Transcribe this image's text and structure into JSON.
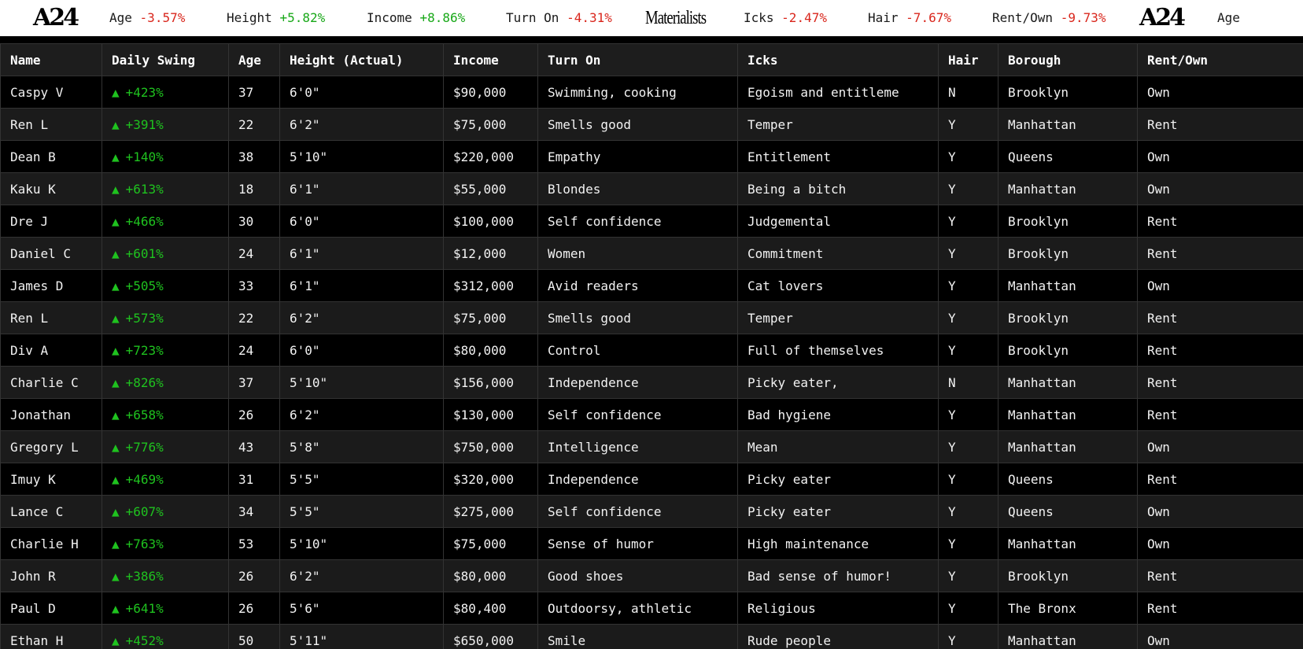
{
  "ticker": {
    "logo_a24": "A24",
    "logo_materialists": "Materialists",
    "items": [
      {
        "label": "Age",
        "value": "-3.57%"
      },
      {
        "label": "Height",
        "value": "+5.82%"
      },
      {
        "label": "Income",
        "value": "+8.86%"
      },
      {
        "label": "Turn On",
        "value": "-4.31%"
      },
      {
        "label": "Icks",
        "value": "-2.47%"
      },
      {
        "label": "Hair",
        "value": "-7.67%"
      },
      {
        "label": "Rent/Own",
        "value": "-9.73%"
      },
      {
        "label": "Age",
        "value": ""
      }
    ]
  },
  "table": {
    "headers": [
      "Name",
      "Daily Swing",
      "Age",
      "Height (Actual)",
      "Income",
      "Turn On",
      "Icks",
      "Hair",
      "Borough",
      "Rent/Own"
    ],
    "swing_icon": "▲",
    "rows": [
      [
        "Caspy V",
        "+423%",
        "37",
        "6'0\"",
        "$90,000",
        "Swimming, cooking",
        "Egoism and entitleme",
        "N",
        "Brooklyn",
        "Own"
      ],
      [
        "Ren L",
        "+391%",
        "22",
        "6'2\"",
        "$75,000",
        "Smells good",
        "Temper",
        "Y",
        "Manhattan",
        "Rent"
      ],
      [
        "Dean B",
        "+140%",
        "38",
        "5'10\"",
        "$220,000",
        "Empathy",
        "Entitlement",
        "Y",
        "Queens",
        "Own"
      ],
      [
        "Kaku K",
        "+613%",
        "18",
        "6'1\"",
        "$55,000",
        "Blondes",
        "Being a bitch",
        "Y",
        "Manhattan",
        "Own"
      ],
      [
        "Dre J",
        "+466%",
        "30",
        "6'0\"",
        "$100,000",
        "Self confidence",
        "Judgemental",
        "Y",
        "Brooklyn",
        "Rent"
      ],
      [
        "Daniel C",
        "+601%",
        "24",
        "6'1\"",
        "$12,000",
        "Women",
        "Commitment",
        "Y",
        "Brooklyn",
        "Rent"
      ],
      [
        "James D",
        "+505%",
        "33",
        "6'1\"",
        "$312,000",
        "Avid readers",
        "Cat lovers",
        "Y",
        "Manhattan",
        "Own"
      ],
      [
        "Ren L",
        "+573%",
        "22",
        "6'2\"",
        "$75,000",
        "Smells good",
        "Temper",
        "Y",
        "Brooklyn",
        "Rent"
      ],
      [
        "Div A",
        "+723%",
        "24",
        "6'0\"",
        "$80,000",
        "Control",
        "Full of themselves",
        "Y",
        "Brooklyn",
        "Rent"
      ],
      [
        "Charlie C",
        "+826%",
        "37",
        "5'10\"",
        "$156,000",
        "Independence",
        "Picky eater,",
        "N",
        "Manhattan",
        "Rent"
      ],
      [
        "Jonathan",
        "+658%",
        "26",
        "6'2\"",
        "$130,000",
        "Self confidence",
        "Bad hygiene",
        "Y",
        "Manhattan",
        "Rent"
      ],
      [
        "Gregory L",
        "+776%",
        "43",
        "5'8\"",
        "$750,000",
        "Intelligence",
        "Mean",
        "Y",
        "Manhattan",
        "Own"
      ],
      [
        "Imuy K",
        "+469%",
        "31",
        "5'5\"",
        "$320,000",
        "Independence",
        "Picky eater",
        "Y",
        "Queens",
        "Rent"
      ],
      [
        "Lance C",
        "+607%",
        "34",
        "5'5\"",
        "$275,000",
        "Self confidence",
        "Picky eater",
        "Y",
        "Queens",
        "Own"
      ],
      [
        "Charlie H",
        "+763%",
        "53",
        "5'10\"",
        "$75,000",
        "Sense of humor",
        "High maintenance",
        "Y",
        "Manhattan",
        "Own"
      ],
      [
        "John R",
        "+386%",
        "26",
        "6'2\"",
        "$80,000",
        "Good shoes",
        "Bad sense of humor!",
        "Y",
        "Brooklyn",
        "Rent"
      ],
      [
        "Paul D",
        "+641%",
        "26",
        "5'6\"",
        "$80,400",
        "Outdoorsy, athletic",
        "Religious",
        "Y",
        "The Bronx",
        "Rent"
      ],
      [
        "Ethan H",
        "+452%",
        "50",
        "5'11\"",
        "$650,000",
        "Smile",
        "Rude people",
        "Y",
        "Manhattan",
        "Own"
      ]
    ]
  }
}
